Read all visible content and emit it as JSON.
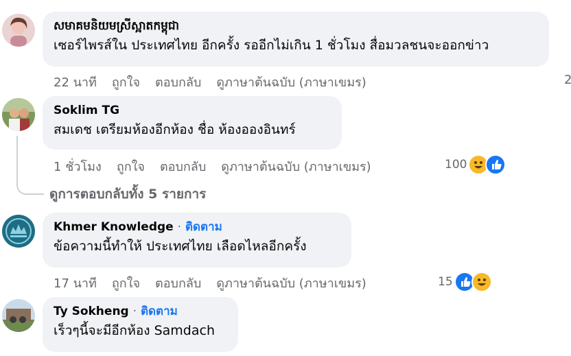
{
  "comments": [
    {
      "author": "សមាគមនិយមស្រីស្អាតកម្ពុជា",
      "text": "เซอร์ไพรส์ใน ประเทศไทย อีกครั้ง รออีกไม่เกิน 1 ชั่วโมง สื่อมวลชนจะออกข่าว",
      "time": "22 นาที",
      "like": "ถูกใจ",
      "reply": "ตอบกลับ",
      "translate": "ดูภาษาต้นฉบับ (ภาษาเขมร)",
      "edge_count": "2"
    },
    {
      "author": "Soklim TG",
      "text": "สมเดช เตรียมห้องอีกห้อง ชื่อ ห้องอองอินทร์",
      "time": "1 ชั่วโมง",
      "like": "ถูกใจ",
      "reply": "ตอบกลับ",
      "translate": "ดูภาษาต้นฉบับ (ภาษาเขมร)",
      "reactions": "100",
      "view_replies": "ดูการตอบกลับทั้ง 5 รายการ"
    },
    {
      "author": "Khmer Knowledge",
      "separator": "·",
      "follow": "ติดตาม",
      "text": "ข้อความนี้ทำให้ ประเทศไทย เลือดไหลอีกครั้ง",
      "time": "17 นาที",
      "like": "ถูกใจ",
      "reply": "ตอบกลับ",
      "translate": "ดูภาษาต้นฉบับ (ภาษาเขมร)",
      "reactions": "15"
    },
    {
      "author": "Ty Sokheng",
      "separator": "·",
      "follow": "ติดตาม",
      "text": "เร็วๆนี้จะมีอีกห้อง Samdach"
    }
  ],
  "colors": {
    "bubble": "#f0f2f5",
    "meta": "#65676b",
    "follow": "#1877f2",
    "haha": "#f7b928",
    "like": "#1877f2"
  }
}
